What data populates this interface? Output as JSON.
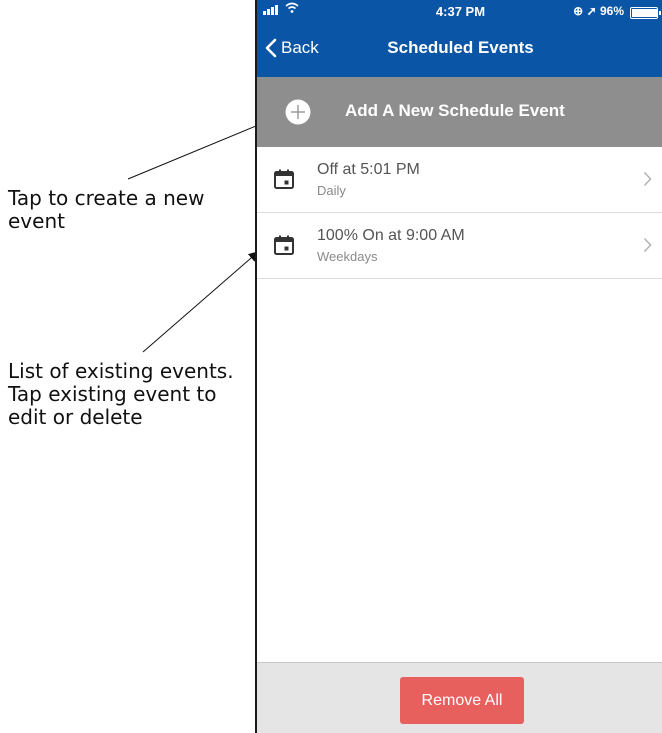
{
  "annotations": {
    "create": "Tap to create a new event",
    "existing": "List of existing events. Tap existing event to edit or delete"
  },
  "status_bar": {
    "time": "4:37 PM",
    "battery": "96%",
    "battery_level": 0.96,
    "icons": [
      "signal-icon",
      "wifi-icon",
      "lock-rotation-icon",
      "location-icon",
      "battery-icon"
    ]
  },
  "header": {
    "back_label": "Back",
    "title": "Scheduled Events"
  },
  "add_event": {
    "label": "Add A New Schedule Event",
    "icon": "plus-circle-icon"
  },
  "events": [
    {
      "title": "Off at 5:01 PM",
      "repeat": "Daily",
      "icon": "calendar-icon"
    },
    {
      "title": "100% On at 9:00 AM",
      "repeat": "Weekdays",
      "icon": "calendar-icon"
    }
  ],
  "footer": {
    "remove_all_label": "Remove All"
  },
  "colors": {
    "header": "#0a55a5",
    "add_row": "#8e8e8e",
    "remove_button": "#e8605e",
    "footer": "#e5e5e5"
  }
}
